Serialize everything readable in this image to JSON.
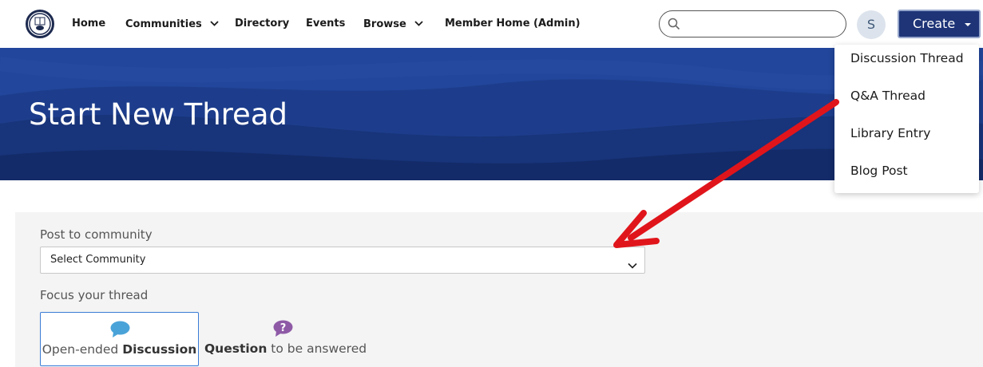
{
  "nav": {
    "items": [
      {
        "label": "Home",
        "has_dropdown": false
      },
      {
        "label": "Communities",
        "has_dropdown": true
      },
      {
        "label": "Directory",
        "has_dropdown": false
      },
      {
        "label": "Events",
        "has_dropdown": false
      },
      {
        "label": "Browse",
        "has_dropdown": true
      },
      {
        "label": "Member Home (Admin)",
        "has_dropdown": false
      }
    ],
    "search": {
      "value": "",
      "placeholder": "",
      "icon": "search-icon"
    },
    "avatar_initial": "S",
    "create_label": "Create"
  },
  "hero": {
    "title": "Start New Thread"
  },
  "create_menu": {
    "items": [
      "Discussion Thread",
      "Q&A Thread",
      "Library Entry",
      "Blog Post"
    ]
  },
  "form": {
    "community_label": "Post to community",
    "community_select": {
      "selected": "Select Community"
    },
    "focus_label": "Focus your thread",
    "focus_options": [
      {
        "prefix": "Open-ended ",
        "bold": "Discussion",
        "suffix": "",
        "icon": "speech-bubble-icon",
        "selected": true
      },
      {
        "prefix": "",
        "bold": "Question",
        "suffix": " to be answered",
        "icon": "question-bubble-icon",
        "selected": false
      }
    ]
  },
  "colors": {
    "brand_navy": "#1e3477",
    "hero_blue": "#1b3a86",
    "annotation_red": "#e0151b",
    "discussion_icon": "#4aa3d8",
    "question_icon": "#8e5aa6",
    "selected_border": "#3a7bd5"
  }
}
